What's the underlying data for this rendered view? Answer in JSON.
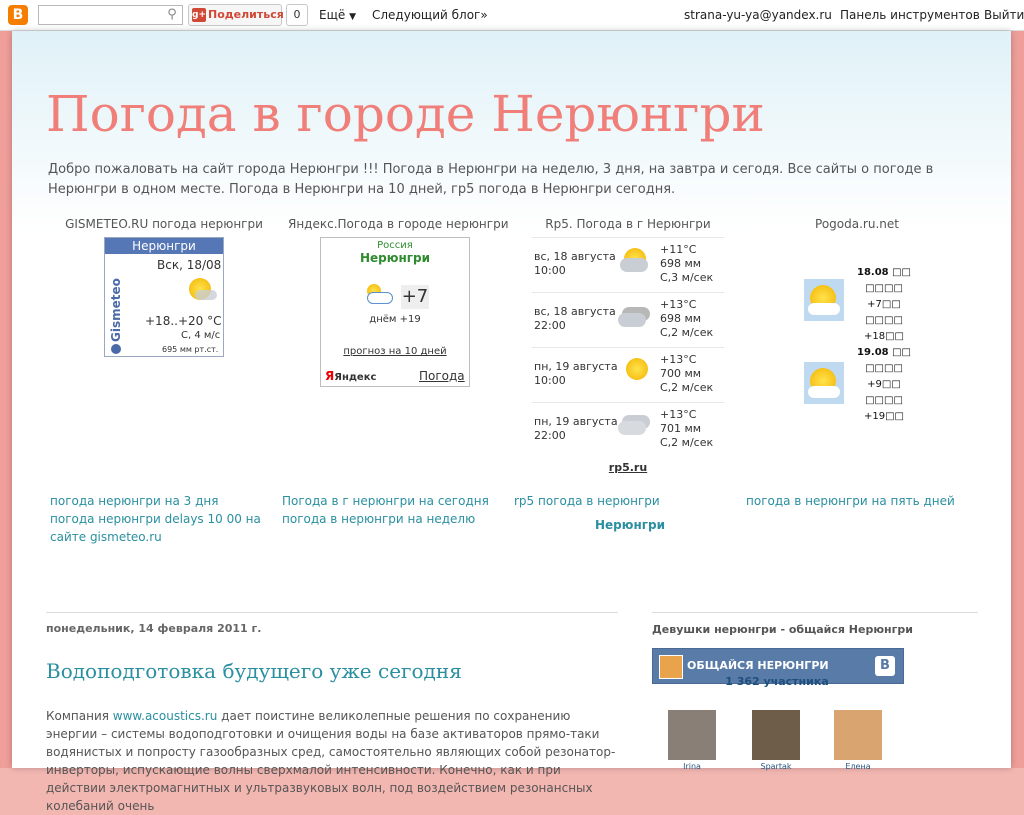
{
  "navbar": {
    "share_label": "Поделиться",
    "share_count": "0",
    "more": "Ещё",
    "next_blog": "Следующий блог»",
    "email": "strana-yu-ya@yandex.ru",
    "dashboard": "Панель инструментов",
    "logout": "Выйти"
  },
  "header": {
    "title": "Погода в городе Нерюнгри",
    "description": "Добро пожаловать на сайт города Нерюнгри !!! Погода в Нерюнгри на неделю, 3 дня, на завтра и сегодя. Все сайты о погоде в Нерюнгри в одном месте. Погода в Нерюнгри на 10 дней, гр5 погода в Нерюнгри сегодня."
  },
  "widgets": {
    "gismeteo": {
      "label": "GISMETEO.RU погода нерюнгри",
      "city": "Нерюнгри",
      "brand": "Gismeteo",
      "date": "Вск, 18/08",
      "temp": "+18..+20 °C",
      "wind": "С, 4 м/с",
      "pressure": "695 мм рт.ст."
    },
    "yandex": {
      "label": "Яндекс.Погода в городе нерюнгри",
      "country": "Россия",
      "city": "Нерюнгри",
      "temp": "+7",
      "day": "днём +19",
      "forecast_link": "прогноз на 10 дней",
      "brand": "Яндекс",
      "weather_link": "Погода"
    },
    "rp5": {
      "label": "Rp5. Погода в г Нерюнгри",
      "rows": [
        {
          "date": "вс, 18 августа",
          "time": "10:00",
          "temp": "+11°C",
          "pressure": "698 мм",
          "wind": "С,3 м/сек",
          "icon": "sun-cloud"
        },
        {
          "date": "вс, 18 августа",
          "time": "22:00",
          "temp": "+13°C",
          "pressure": "698 мм",
          "wind": "С,2 м/сек",
          "icon": "moon-cloud"
        },
        {
          "date": "пн, 19 августа",
          "time": "10:00",
          "temp": "+13°C",
          "pressure": "700 мм",
          "wind": "С,2 м/сек",
          "icon": "sun"
        },
        {
          "date": "пн, 19 августа",
          "time": "22:00",
          "temp": "+13°C",
          "pressure": "701 мм",
          "wind": "С,2 м/сек",
          "icon": "cloud"
        }
      ],
      "footer": "rp5.ru"
    },
    "pogoda": {
      "label": "Pogoda.ru.net",
      "d1_date": "18.08 □□",
      "d1_a": "□□□□",
      "d1_b": "+7□□",
      "d1_c": "□□□□",
      "d1_d": "+18□□",
      "d2_date": "19.08 □□",
      "d2_a": "□□□□",
      "d2_b": "+9□□",
      "d2_c": "□□□□",
      "d2_d": "+19□□"
    }
  },
  "links": {
    "col1_a": "погода нерюнгри на 3 дня",
    "col1_b": "погода нерюнгри delays 10 00 на",
    "col1_c": "сайте gismeteo.ru",
    "col2_a": "Погода в г нерюнгри на сегодня",
    "col2_b": "погода в нерюнгри на неделю",
    "col3_a": "rp5 погода в нерюнгри",
    "col3_b": "Нерюнгри",
    "col4_a": "погода в нерюнгри на пять дней"
  },
  "post": {
    "date": "понедельник, 14 февраля 2011 г.",
    "title": "Водоподготовка будущего уже сегодня",
    "body_pre": "Компания ",
    "body_link": "www.acoustics.ru",
    "body_post": " дает поистине великолепные решения по сохранению энергии – системы водоподготовки и очищения воды на базе активаторов прямо-таки водянистых и попросту газообразных сред, самостоятельно являющих собой резонатор-инверторы, испускающие волны сверхмалой интенсивности. Конечно, как и при действии электромагнитных и ультразвуковых волн, под воздействием резонансных колебаний очень"
  },
  "sidebar": {
    "title": "Девушки нерюнгри - общайся Нерюнгри",
    "vk_label": "ОБЩАЙСЯ НЕРЮНГРИ",
    "vk_logo": "В",
    "members": "1 362 участника",
    "faces": [
      {
        "name": "Irina"
      },
      {
        "name": "Spartak"
      },
      {
        "name": "Елена"
      }
    ]
  },
  "colors": {
    "title": "#f07e79",
    "link": "#2a8fa0",
    "vk": "#587ba8",
    "background": "#ef9e99"
  }
}
